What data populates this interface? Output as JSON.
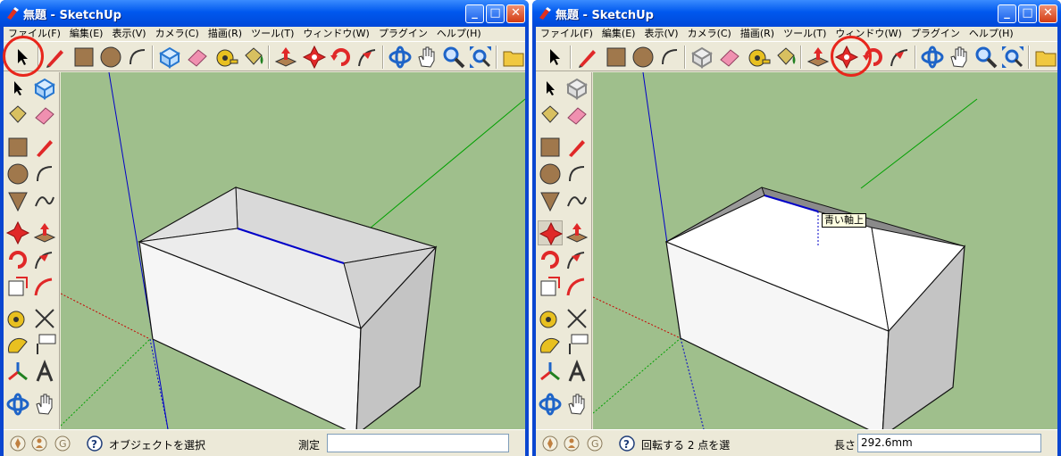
{
  "left_window": {
    "title": "無題 - SketchUp",
    "menu": [
      "ファイル(F)",
      "編集(E)",
      "表示(V)",
      "カメラ(C)",
      "描画(R)",
      "ツール(T)",
      "ウィンドウ(W)",
      "プラグイン",
      "ヘルプ(H)"
    ],
    "status_text": "オブジェクトを選択",
    "measure_label": "測定",
    "measure_value": "",
    "highlighted_tool": "select-tool"
  },
  "right_window": {
    "title": "無題 - SketchUp",
    "menu": [
      "ファイル(F)",
      "編集(E)",
      "表示(V)",
      "カメラ(C)",
      "描画(R)",
      "ツール(T)",
      "ウィンドウ(W)",
      "プラグイン",
      "ヘルプ(H)"
    ],
    "status_text": "回転する 2 点を選",
    "measure_label": "長さ",
    "measure_value": "292.6mm",
    "tooltip": "青い軸上",
    "highlighted_tool": "move-tool"
  },
  "window_controls": {
    "minimize": "_",
    "maximize": "□",
    "close": "✕"
  },
  "colors": {
    "viewport_bg": "#9fbf8c",
    "highlight_circle": "#e8261c",
    "blue_axis": "#0000c8",
    "green_axis": "#00a000",
    "red_axis": "#c80000"
  },
  "icons": {
    "toolbar": [
      "select-icon",
      "pencil-icon",
      "rectangle-icon",
      "circle-icon",
      "arc-icon",
      "make-component-icon",
      "eraser-icon",
      "tape-measure-icon",
      "paint-bucket-icon",
      "push-pull-icon",
      "move-icon",
      "rotate-icon",
      "follow-me-icon",
      "orbit-icon",
      "pan-icon",
      "zoom-icon",
      "zoom-extents-icon",
      "folder-icon"
    ]
  }
}
